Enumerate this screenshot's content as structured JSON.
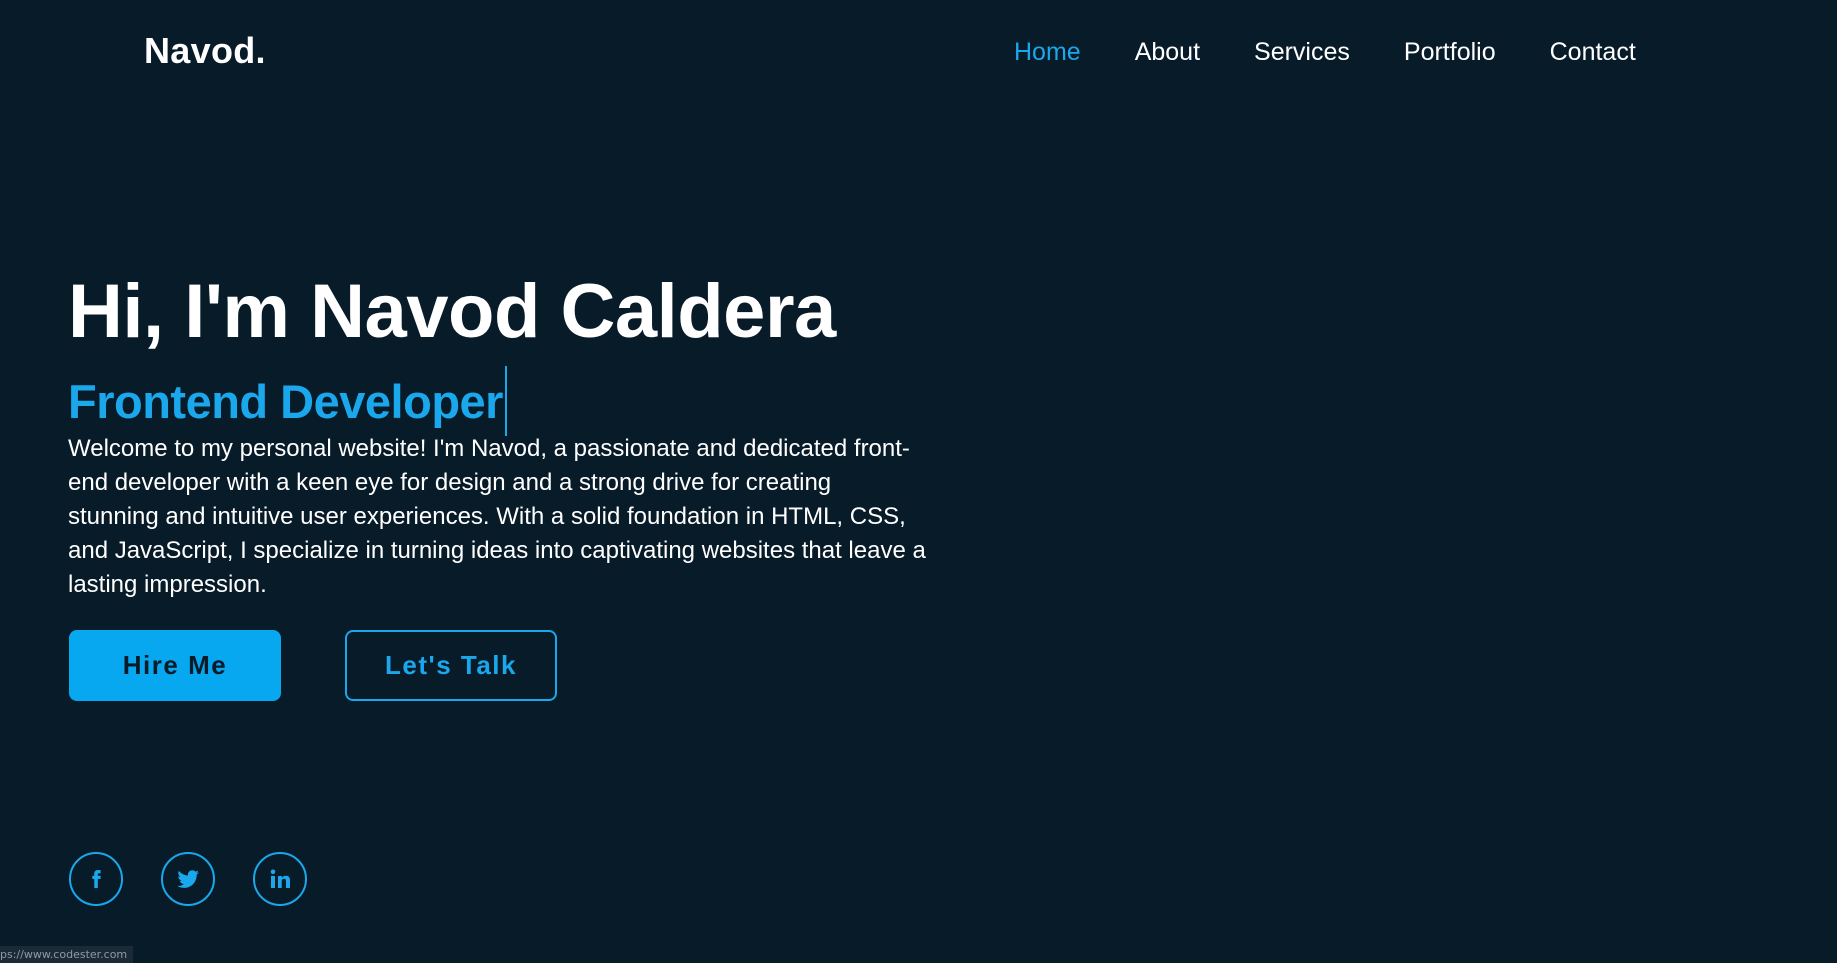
{
  "header": {
    "logo": "Navod.",
    "nav": [
      {
        "label": "Home",
        "active": true
      },
      {
        "label": "About",
        "active": false
      },
      {
        "label": "Services",
        "active": false
      },
      {
        "label": "Portfolio",
        "active": false
      },
      {
        "label": "Contact",
        "active": false
      }
    ]
  },
  "hero": {
    "title": "Hi, I'm Navod Caldera",
    "role": "Frontend Developer",
    "description": "Welcome to my personal website! I'm Navod, a passionate and dedicated front-end developer with a keen eye for design and a strong drive for creating stunning and intuitive user experiences. With a solid foundation in HTML, CSS, and JavaScript, I specialize in turning ideas into captivating websites that leave a lasting impression.",
    "hire_label": "Hire Me",
    "talk_label": "Let's Talk"
  },
  "social": [
    {
      "icon": "facebook-icon"
    },
    {
      "icon": "twitter-icon"
    },
    {
      "icon": "linkedin-icon"
    }
  ],
  "status_bar": {
    "url": "ps://www.codester.com"
  },
  "colors": {
    "background": "#081b29",
    "accent": "#1aa7ec",
    "text": "#ffffff"
  }
}
